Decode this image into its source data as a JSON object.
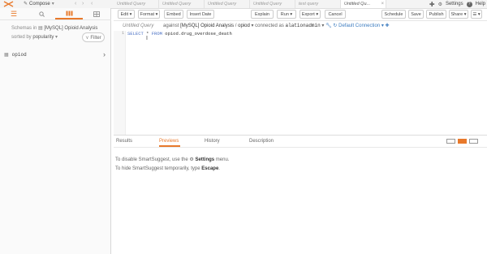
{
  "topbar": {
    "compose_label": "Compose",
    "tabs": [
      {
        "label": "Untitled Query",
        "active": false
      },
      {
        "label": "Untitled Query",
        "active": false
      },
      {
        "label": "Untitled Query",
        "active": false
      },
      {
        "label": "Untitled Query",
        "active": false
      },
      {
        "label": "test query",
        "active": false
      },
      {
        "label": "Untitled Qu...",
        "active": true
      }
    ],
    "settings_label": "Settings",
    "help_label": "Help"
  },
  "left_panel": {
    "schema_prefix": "Schemas in",
    "schema_name": "[MySQL] Opioid Analysis",
    "sorted_prefix": "sorted by",
    "sorted_value": "popularity",
    "filter_label": "Filter",
    "items": [
      {
        "label": "opiod"
      }
    ]
  },
  "toolbar": {
    "edit_label": "Edit",
    "format_label": "Format",
    "embed_label": "Embed",
    "insert_date_label": "Insert Date",
    "explain_label": "Explain",
    "run_label": "Run",
    "export_label": "Export",
    "cancel_label": "Cancel",
    "schedule_label": "Schedule",
    "save_label": "Save",
    "publish_label": "Publish",
    "share_label": "Share"
  },
  "connection": {
    "query_name": "Untitled Query",
    "against_label": "against",
    "datasource": "[MySQL] Opioid Analysis",
    "separator": "/",
    "schema": "opiod",
    "connected_as_label": "connected as",
    "user": "alationadmin",
    "connection_name": "Default Connection"
  },
  "editor": {
    "line_number": "1",
    "keyword_select": "SELECT",
    "star": "*",
    "keyword_from": "FROM",
    "table": "opiod.drug_overdose_death"
  },
  "results": {
    "tabs": [
      {
        "label": "Results",
        "active": false
      },
      {
        "label": "Previews",
        "active": true
      },
      {
        "label": "History",
        "active": false
      },
      {
        "label": "Description",
        "active": false
      }
    ]
  },
  "help": {
    "line1_pre": "To disable SmartSuggest, use the",
    "line1_link": "Settings",
    "line1_post": "menu.",
    "line2_pre": "To hide SmartSuggest temporarily, type",
    "line2_key": "Escape",
    "line2_post": "."
  },
  "colors": {
    "accent": "#e8792b",
    "link": "#3b7bbf",
    "keyword": "#4a70c4"
  }
}
